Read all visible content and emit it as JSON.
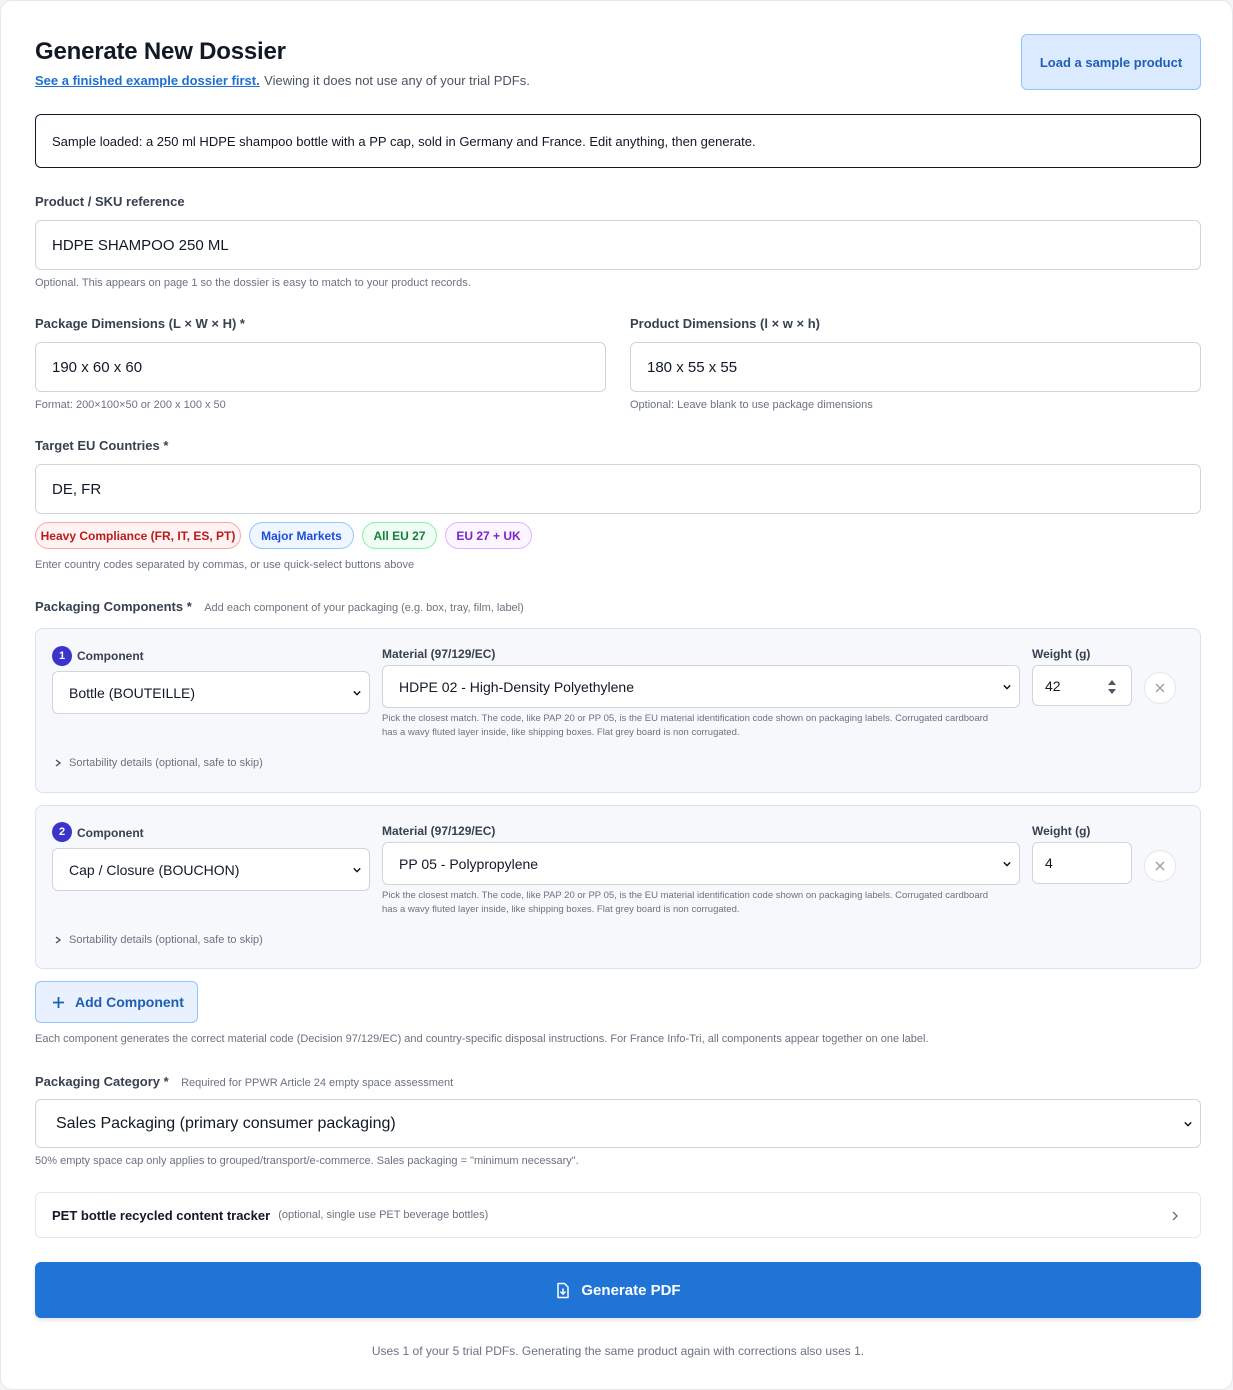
{
  "header": {
    "title": "Generate New Dossier",
    "example_link": "See a finished example dossier first.",
    "example_note": "Viewing it does not use any of your trial PDFs.",
    "sample_button": "Load a sample product"
  },
  "notice": "Sample loaded: a 250 ml HDPE shampoo bottle with a PP cap, sold in Germany and France. Edit anything, then generate.",
  "sku": {
    "label": "Product / SKU reference",
    "value": "HDPE SHAMPOO 250 ML",
    "hint": "Optional. This appears on page 1 so the dossier is easy to match to your product records."
  },
  "package_dims": {
    "label": "Package Dimensions (L × W × H) *",
    "value": "190 x 60 x 60",
    "hint": "Format: 200×100×50 or 200 x 100 x 50"
  },
  "product_dims": {
    "label": "Product Dimensions (l × w × h)",
    "value": "180 x 55 x 55",
    "hint": "Optional: Leave blank to use package dimensions"
  },
  "countries": {
    "label": "Target EU Countries *",
    "value": "DE, FR",
    "chips": [
      "Heavy Compliance (FR, IT, ES, PT)",
      "Major Markets",
      "All EU 27",
      "EU 27 + UK"
    ],
    "hint": "Enter country codes separated by commas, or use quick-select buttons above"
  },
  "components": {
    "label": "Packaging Components *",
    "sublabel": "Add each component of your packaging (e.g. box, tray, film, label)",
    "component_label": "Component",
    "material_label": "Material (97/129/EC)",
    "weight_label": "Weight (g)",
    "material_hint_1": "Pick the closest match. The code, like PAP 20 or PP 05, is the EU material identification code shown on packaging labels. Corrugated cardboard",
    "material_hint_2": "has a wavy fluted layer inside, like shipping boxes. Flat grey board is non corrugated.",
    "sortability": "Sortability details (optional, safe to skip)",
    "items": [
      {
        "num": "1",
        "component": "Bottle (BOUTEILLE)",
        "material": "HDPE 02 - High-Density Polyethylene",
        "weight": "42"
      },
      {
        "num": "2",
        "component": "Cap / Closure (BOUCHON)",
        "material": "PP 05 - Polypropylene",
        "weight": "4"
      }
    ],
    "add_button": "Add Component",
    "footer": "Each component generates the correct material code (Decision 97/129/EC) and country-specific disposal instructions. For France Info-Tri, all components appear together on one label."
  },
  "category": {
    "label": "Packaging Category *",
    "sublabel": "Required for PPWR Article 24 empty space assessment",
    "value": "Sales Packaging (primary consumer packaging)",
    "hint": "50% empty space cap only applies to grouped/transport/e-commerce. Sales packaging = \"minimum necessary\"."
  },
  "tracker": {
    "title": "PET bottle recycled content tracker",
    "note": "(optional, single use PET beverage bottles)"
  },
  "generate_button": "Generate PDF",
  "footer_note": "Uses 1 of your 5 trial PDFs. Generating the same product again with corrections also uses 1."
}
